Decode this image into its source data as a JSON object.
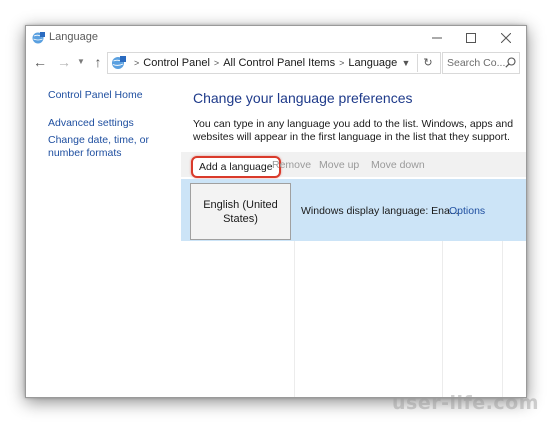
{
  "window": {
    "title": "Language"
  },
  "address_bar": {
    "crumbs": [
      "Control Panel",
      "All Control Panel Items",
      "Language"
    ],
    "separator": ">"
  },
  "search": {
    "placeholder": "Search Co..."
  },
  "left_nav": {
    "items": [
      "Control Panel Home",
      "Advanced settings",
      "Change date, time, or number formats"
    ]
  },
  "main": {
    "heading": "Change your language preferences",
    "description": "You can type in any language you add to the list. Windows, apps and websites will appear in the first language in the list that they support."
  },
  "toolbar": {
    "add_label": "Add a language",
    "remove_label": "Remove",
    "move_up_label": "Move up",
    "move_down_label": "Move down"
  },
  "languages": [
    {
      "name": "English (United States)",
      "display": "Windows display language: Ena...",
      "options": "Options"
    }
  ],
  "watermark": "user-life.com",
  "colors": {
    "link": "#1f4fa0",
    "heading": "#1e3a8a",
    "selection": "#cce4f7",
    "highlight": "#d93a2b"
  }
}
